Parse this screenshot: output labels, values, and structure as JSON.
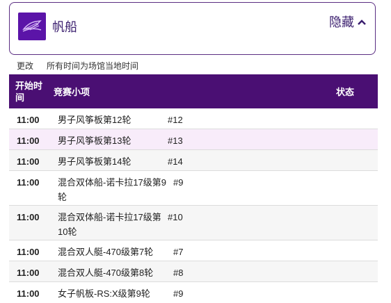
{
  "sport": {
    "name": "帆船",
    "toggle_label": "隐藏",
    "icon": "sailing-icon"
  },
  "meta": {
    "update_label": "更改",
    "timezone_note": "所有时间为场馆当地时间"
  },
  "table": {
    "headers": {
      "time": "开始时间",
      "event": "竞赛小项",
      "status": "状态"
    },
    "rows": [
      {
        "time": "11:00",
        "event": "男子风筝板第12轮",
        "num": "#12",
        "status": ""
      },
      {
        "time": "11:00",
        "event": "男子风筝板第13轮",
        "num": "#13",
        "status": ""
      },
      {
        "time": "11:00",
        "event": "男子风筝板第14轮",
        "num": "#14",
        "status": ""
      },
      {
        "time": "11:00",
        "event": "混合双体船-诺卡拉17级第9轮",
        "num": "#9",
        "status": ""
      },
      {
        "time": "11:00",
        "event": "混合双体船-诺卡拉17级第10轮",
        "num": "#10",
        "status": ""
      },
      {
        "time": "11:00",
        "event": "混合双人艇-470级第7轮",
        "num": "#7",
        "status": ""
      },
      {
        "time": "11:00",
        "event": "混合双人艇-470级第8轮",
        "num": "#8",
        "status": ""
      },
      {
        "time": "11:00",
        "event": "女子帆板-RS:X级第9轮",
        "num": "#9",
        "status": ""
      }
    ]
  },
  "colors": {
    "header_bg": "#4a0f73",
    "accent": "#5b14a8",
    "highlight_row": "#f8ecfa"
  }
}
